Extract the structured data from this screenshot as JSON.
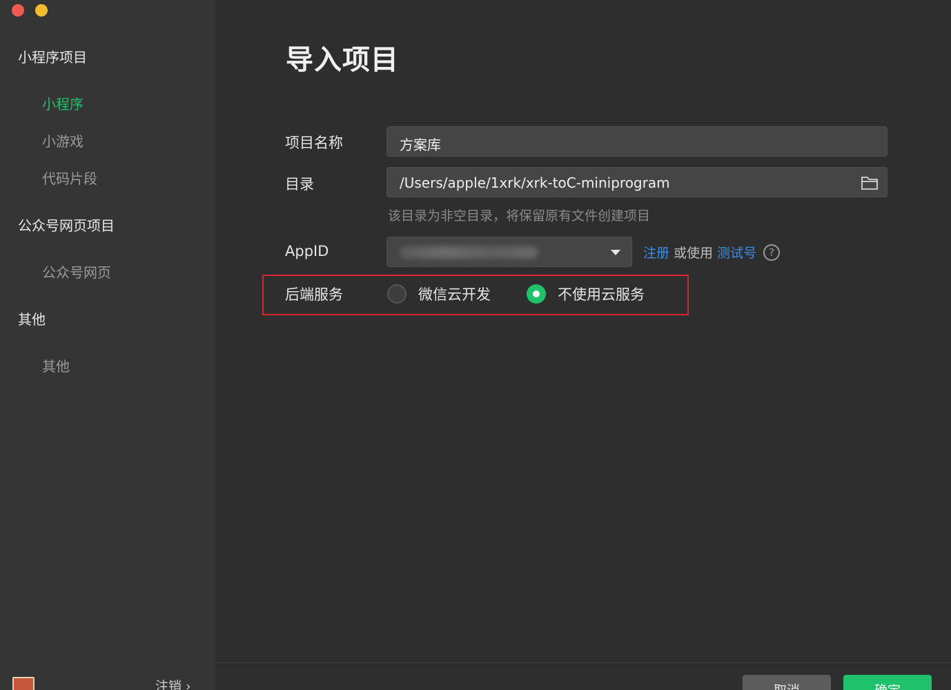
{
  "window": {
    "title": "导入项目"
  },
  "sidebar": {
    "groups": [
      {
        "title": "小程序项目",
        "items": [
          {
            "label": "小程序",
            "active": true
          },
          {
            "label": "小游戏",
            "active": false
          },
          {
            "label": "代码片段",
            "active": false
          }
        ]
      },
      {
        "title": "公众号网页项目",
        "items": [
          {
            "label": "公众号网页",
            "active": false
          }
        ]
      },
      {
        "title": "其他",
        "items": [
          {
            "label": "其他",
            "active": false
          }
        ]
      }
    ],
    "logout_label": "注销 ›"
  },
  "form": {
    "project_name_label": "项目名称",
    "project_name_value": "方案库",
    "directory_label": "目录",
    "directory_value": "/Users/apple/1xrk/xrk-toC-miniprogram",
    "directory_hint": "该目录为非空目录，将保留原有文件创建项目",
    "appid_label": "AppID",
    "register_link": "注册",
    "or_use_text": "或使用",
    "test_account_link": "测试号",
    "help_symbol": "?",
    "backend_label": "后端服务",
    "backend_options": [
      {
        "label": "微信云开发",
        "selected": false
      },
      {
        "label": "不使用云服务",
        "selected": true
      }
    ]
  },
  "buttons": {
    "cancel": "取消",
    "confirm": "确定"
  },
  "colors": {
    "accent": "#1fc16a",
    "link": "#3a8ee6",
    "highlight": "#d9262e"
  }
}
